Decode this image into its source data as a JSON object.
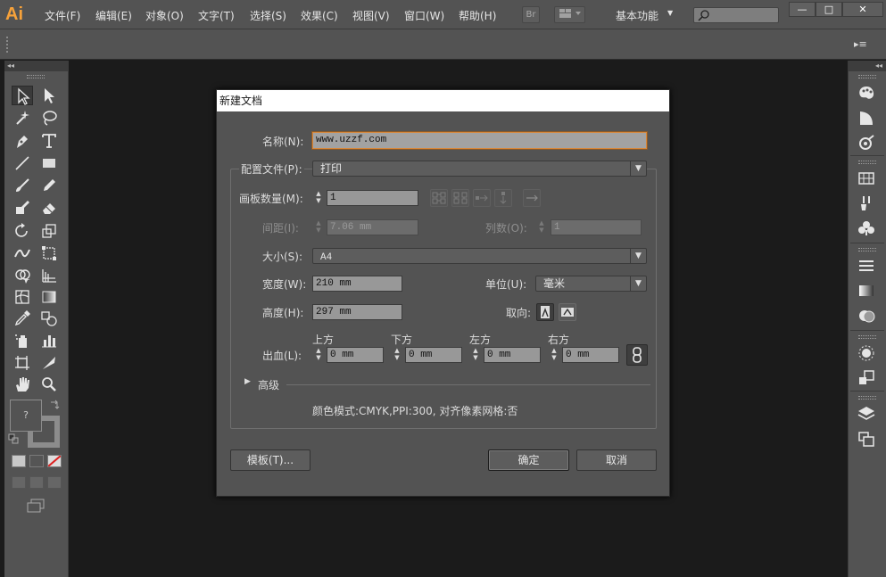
{
  "app": {
    "logo": "Ai"
  },
  "menu": [
    "文件(F)",
    "编辑(E)",
    "对象(O)",
    "文字(T)",
    "选择(S)",
    "效果(C)",
    "视图(V)",
    "窗口(W)",
    "帮助(H)"
  ],
  "menubar": {
    "bridge": "Br",
    "workspace": "基本功能"
  },
  "window_buttons": {
    "minimize": "—",
    "maximize": "□",
    "close": "✕"
  },
  "dialog": {
    "title": "新建文档",
    "name_label": "名称(N):",
    "name_value": "www.uzzf.com",
    "profile_label": "配置文件(P):",
    "profile_value": "打印",
    "artboards_label": "画板数量(M):",
    "artboards_value": "1",
    "spacing_label": "间距(I):",
    "spacing_value": "7.06 mm",
    "columns_label": "列数(O):",
    "columns_value": "1",
    "size_label": "大小(S):",
    "size_value": "A4",
    "width_label": "宽度(W):",
    "width_value": "210 mm",
    "units_label": "单位(U):",
    "units_value": "毫米",
    "height_label": "高度(H):",
    "height_value": "297 mm",
    "orientation_label": "取向:",
    "bleed_label": "出血(L):",
    "bleed": [
      {
        "label": "上方",
        "value": "0 mm"
      },
      {
        "label": "下方",
        "value": "0 mm"
      },
      {
        "label": "左方",
        "value": "0 mm"
      },
      {
        "label": "右方",
        "value": "0 mm"
      }
    ],
    "advanced_label": "高级",
    "info": "颜色模式:CMYK,PPI:300, 对齐像素网格:否",
    "templates_button": "模板(T)...",
    "ok_button": "确定",
    "cancel_button": "取消"
  },
  "tools": {
    "fill_placeholder": "?"
  }
}
